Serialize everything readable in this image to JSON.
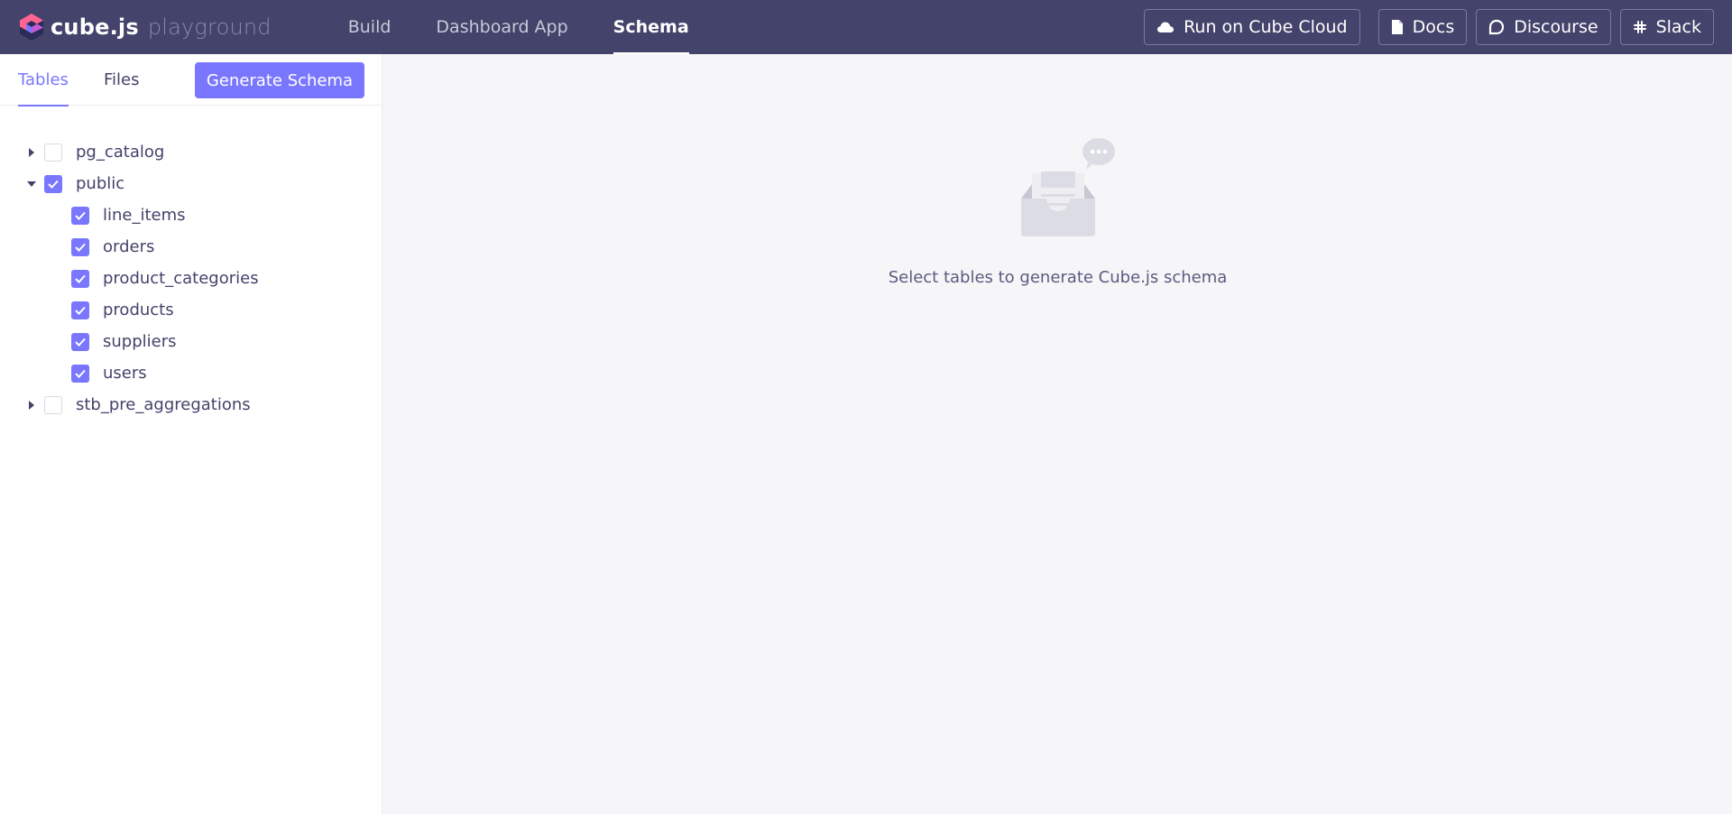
{
  "header": {
    "brand": "cube.js",
    "brand_sub": "playground",
    "nav": [
      {
        "label": "Build"
      },
      {
        "label": "Dashboard App"
      },
      {
        "label": "Schema"
      }
    ],
    "actions": {
      "cloud": "Run on Cube Cloud",
      "docs": "Docs",
      "discourse": "Discourse",
      "slack": "Slack"
    }
  },
  "sidebar": {
    "tabs": [
      {
        "label": "Tables"
      },
      {
        "label": "Files"
      }
    ],
    "generate_label": "Generate Schema",
    "tree": [
      {
        "label": "pg_catalog",
        "checked": false,
        "expanded": false
      },
      {
        "label": "public",
        "checked": true,
        "expanded": true,
        "children": [
          {
            "label": "line_items",
            "checked": true
          },
          {
            "label": "orders",
            "checked": true
          },
          {
            "label": "product_categories",
            "checked": true
          },
          {
            "label": "products",
            "checked": true
          },
          {
            "label": "suppliers",
            "checked": true
          },
          {
            "label": "users",
            "checked": true
          }
        ]
      },
      {
        "label": "stb_pre_aggregations",
        "checked": false,
        "expanded": false
      }
    ]
  },
  "main": {
    "empty_text": "Select tables to generate Cube.js schema"
  },
  "colors": {
    "header_bg": "#43436b",
    "accent": "#7a77ff",
    "text": "#43436b"
  }
}
